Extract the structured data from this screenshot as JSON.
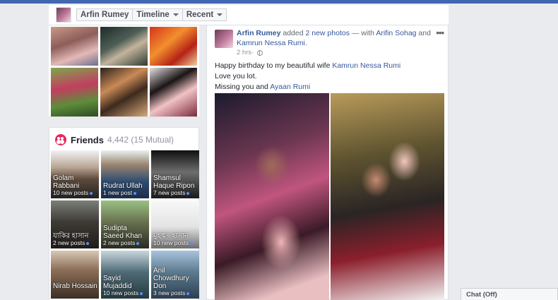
{
  "header": {
    "name": "Arfin Rumey",
    "crumb_timeline": "Timeline",
    "crumb_recent": "Recent"
  },
  "friends": {
    "title": "Friends",
    "count": "4,442 (15 Mutual)",
    "items": [
      {
        "name": "Golam Rabbani",
        "posts": "10 new posts"
      },
      {
        "name": "Rudrat Ullah",
        "posts": "1 new post"
      },
      {
        "name": "Shamsul Haque Ripon",
        "posts": "7 new posts"
      },
      {
        "name": "যাকির হাসান",
        "posts": "2 new posts"
      },
      {
        "name": "Sudipta Saeed Khan",
        "posts": "2 new posts"
      },
      {
        "name": "মুহম্মদ হাসান",
        "posts": "10 new posts"
      },
      {
        "name": "Nirab Hossain",
        "posts": ""
      },
      {
        "name": "Sayid Mujaddid",
        "posts": "10 new posts"
      },
      {
        "name": "Anil Chowdhury Don",
        "posts": "3 new posts"
      }
    ]
  },
  "post": {
    "author": "Arfin Rumey",
    "action": " added ",
    "photos_link": "2 new photos",
    "with_text": " — with ",
    "tag1": "Arifin Sohag",
    "and_text": " and ",
    "tag2": "Kamrun Nessa Rumi",
    "end": ".",
    "time": "2 hrs",
    "sep": " · ",
    "line1_prefix": "Happy birthday to my beautiful wife ",
    "line1_link": "Kamrun Nessa Rumi",
    "line2": "Love you lot.",
    "line3_prefix": "Missing you and ",
    "line3_link": "Ayaan Rumi",
    "more": "•••"
  },
  "chat": {
    "label": "Chat (Off)"
  },
  "colors": {
    "brand": "#4267b2",
    "link": "#365899",
    "friends_icon": "#e4265b"
  }
}
